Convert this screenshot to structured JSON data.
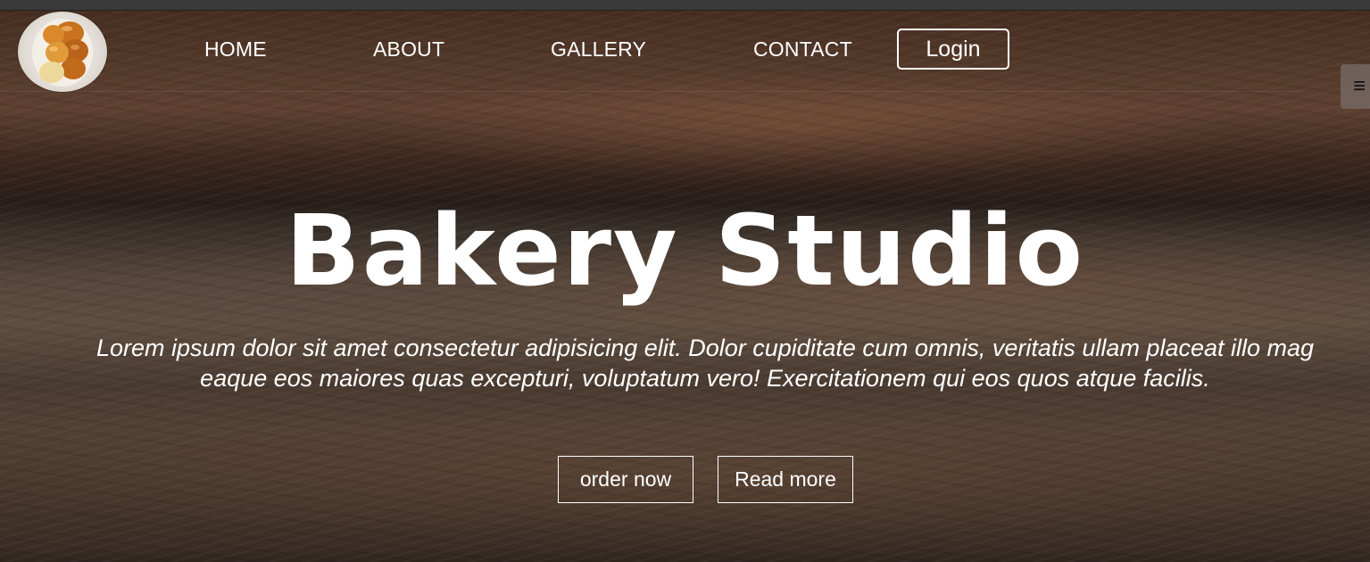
{
  "nav": {
    "logo_alt": "bakery logo",
    "links": [
      {
        "label": "HOME"
      },
      {
        "label": "ABOUT"
      },
      {
        "label": "GALLERY"
      },
      {
        "label": "CONTACT"
      }
    ],
    "login_label": "Login",
    "menu_icon": "≡"
  },
  "hero": {
    "title": "Bakery Studio",
    "text_line1": "Lorem ipsum dolor sit amet consectetur adipisicing elit. Dolor cupiditate cum omnis, veritatis ullam placeat illo mag",
    "text_line2": "eaque eos maiores quas excepturi, voluptatum vero! Exercitationem qui eos quos atque facilis.",
    "primary_cta": "order now",
    "secondary_cta": "Read more"
  },
  "colors": {
    "text": "#ffffff",
    "background_tone": "#5a4638"
  }
}
